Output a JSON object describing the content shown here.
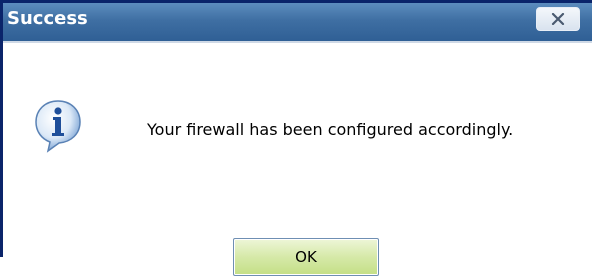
{
  "dialog": {
    "title": "Success",
    "message": "Your firewall has been configured accordingly.",
    "ok_label": "OK",
    "icon": "info-icon"
  },
  "colors": {
    "titlebar": "#3f6fa3",
    "ok_button": "#d6e9a8",
    "window_border": "#0a246a"
  }
}
